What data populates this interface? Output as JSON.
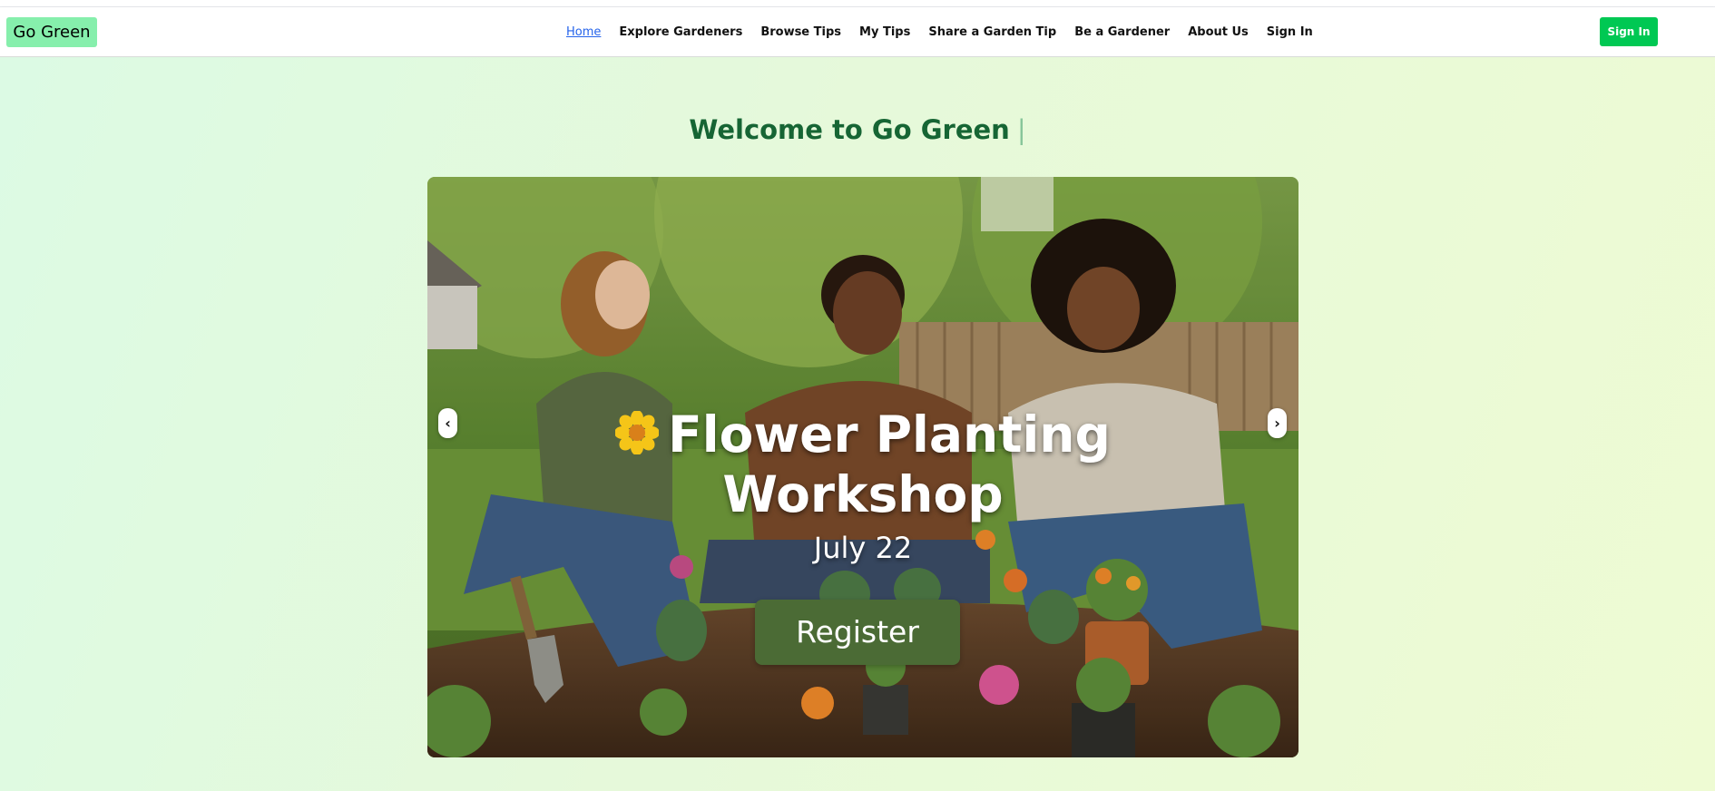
{
  "brand": {
    "logo_text": "Go Green"
  },
  "nav": {
    "items": [
      {
        "label": "Home",
        "active": true
      },
      {
        "label": "Explore Gardeners"
      },
      {
        "label": "Browse Tips"
      },
      {
        "label": "My Tips"
      },
      {
        "label": "Share a Garden Tip"
      },
      {
        "label": "Be a Gardener"
      },
      {
        "label": "About Us"
      },
      {
        "label": "Sign In"
      }
    ],
    "signin_button": "Sign In"
  },
  "hero": {
    "heading": "Welcome to Go Green",
    "cursor": "|",
    "slide": {
      "icon": "flower-emoji-icon",
      "title_line1": "Flower Planting",
      "title_line2": "Workshop",
      "date": "July 22",
      "button": "Register",
      "prev_arrow": "‹",
      "next_arrow": "›"
    }
  },
  "colors": {
    "logo_bg": "#86efac",
    "signin_bg": "#00c853",
    "heading": "#166534",
    "register_bg": "#4b6b35",
    "active_link": "#2563eb"
  }
}
